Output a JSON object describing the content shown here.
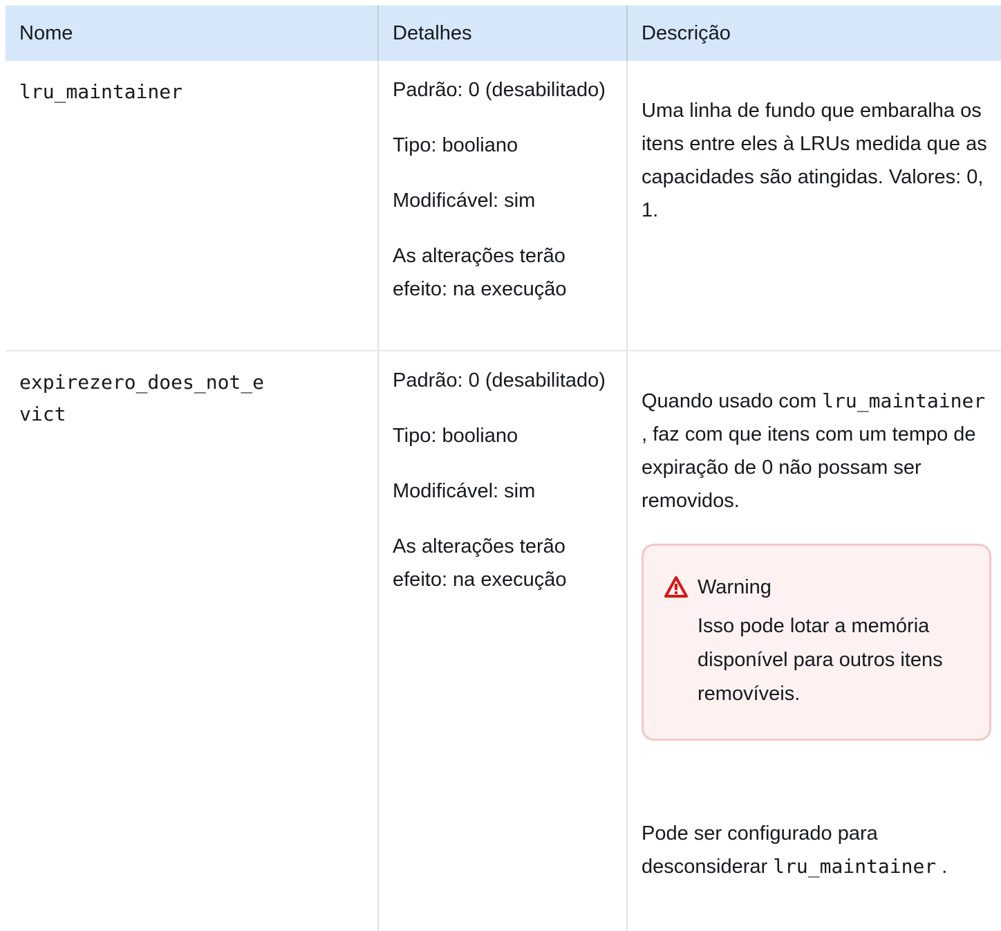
{
  "headers": {
    "name": "Nome",
    "details": "Detalhes",
    "description": "Descrição"
  },
  "rows": [
    {
      "name": "lru_maintainer",
      "details": {
        "default": "Padrão: 0 (desabilitado)",
        "type": "Tipo: booliano",
        "modifiable": "Modificável: sim",
        "changes": "As alterações terão efeito: na execução"
      },
      "description": "Uma linha de fundo que embaralha os itens entre eles à LRUs medida que as capacidades são atingidas. Valores: 0, 1."
    },
    {
      "name": "expirezero_does_not_evict",
      "details": {
        "default": "Padrão: 0 (desabilitado)",
        "type": "Tipo: booliano",
        "modifiable": "Modificável: sim",
        "changes": "As alterações terão efeito: na execução"
      },
      "description_pre": "Quando usado com ",
      "description_code": "lru_maintainer",
      "description_post": " , faz com que itens com um tempo de expiração de 0 não possam ser removidos.",
      "warning": {
        "title": "Warning",
        "body": "Isso pode lotar a memória disponível para outros itens removíveis."
      },
      "note_pre": "Pode ser configurado para desconsiderar ",
      "note_code": "lru_maintainer",
      "note_post": " ."
    }
  ]
}
